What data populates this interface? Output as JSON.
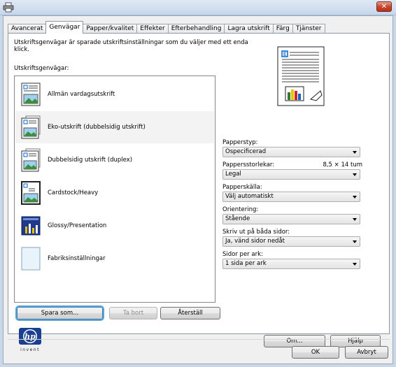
{
  "window": {
    "close_label": "✕"
  },
  "tabs": [
    {
      "label": "Avancerat"
    },
    {
      "label": "Genvägar"
    },
    {
      "label": "Papper/kvalitet"
    },
    {
      "label": "Effekter"
    },
    {
      "label": "Efterbehandling"
    },
    {
      "label": "Lagra utskrift"
    },
    {
      "label": "Färg"
    },
    {
      "label": "Tjänster"
    }
  ],
  "panel": {
    "description": "Utskriftsgenvägar är sparade utskriftsinställningar som du väljer med ett enda klick.",
    "shortcuts_label": "Utskriftsgenvägar:",
    "shortcuts": [
      {
        "label": "Allmän vardagsutskrift",
        "icon": "document-icon"
      },
      {
        "label": "Eko-utskrift (dubbelsidig utskrift)",
        "icon": "duplex-document-icon"
      },
      {
        "label": "Dubbelsidig utskrift (duplex)",
        "icon": "duplex-document-icon"
      },
      {
        "label": "Cardstock/Heavy",
        "icon": "cardstock-icon"
      },
      {
        "label": "Glossy/Presentation",
        "icon": "presentation-icon"
      },
      {
        "label": "Fabriksinställningar",
        "icon": "blank-page-icon"
      }
    ],
    "fields": {
      "paper_type_label": "Papperstyp:",
      "paper_type_value": "Ospecificerad",
      "paper_size_label": "Pappersstorlekar:",
      "paper_size_dims": "8,5 × 14 tum",
      "paper_size_value": "Legal",
      "paper_source_label": "Papperskälla:",
      "paper_source_value": "Välj automatiskt",
      "orientation_label": "Orientering:",
      "orientation_value": "Stående",
      "duplex_label": "Skriv ut på båda sidor:",
      "duplex_value": "Ja, vänd sidor nedåt",
      "pages_per_sheet_label": "Sidor per ark:",
      "pages_per_sheet_value": "1 sida per ark"
    },
    "buttons": {
      "save_as": "Spara som...",
      "delete": "Ta bort",
      "reset": "Återställ",
      "about": "Om...",
      "help": "Hjälp"
    },
    "hp_logo_text": "invent"
  },
  "footer": {
    "ok": "OK",
    "cancel": "Avbryt"
  },
  "colors": {
    "selection_focus": "#5aa3d8",
    "close_button": "#c8452c"
  }
}
